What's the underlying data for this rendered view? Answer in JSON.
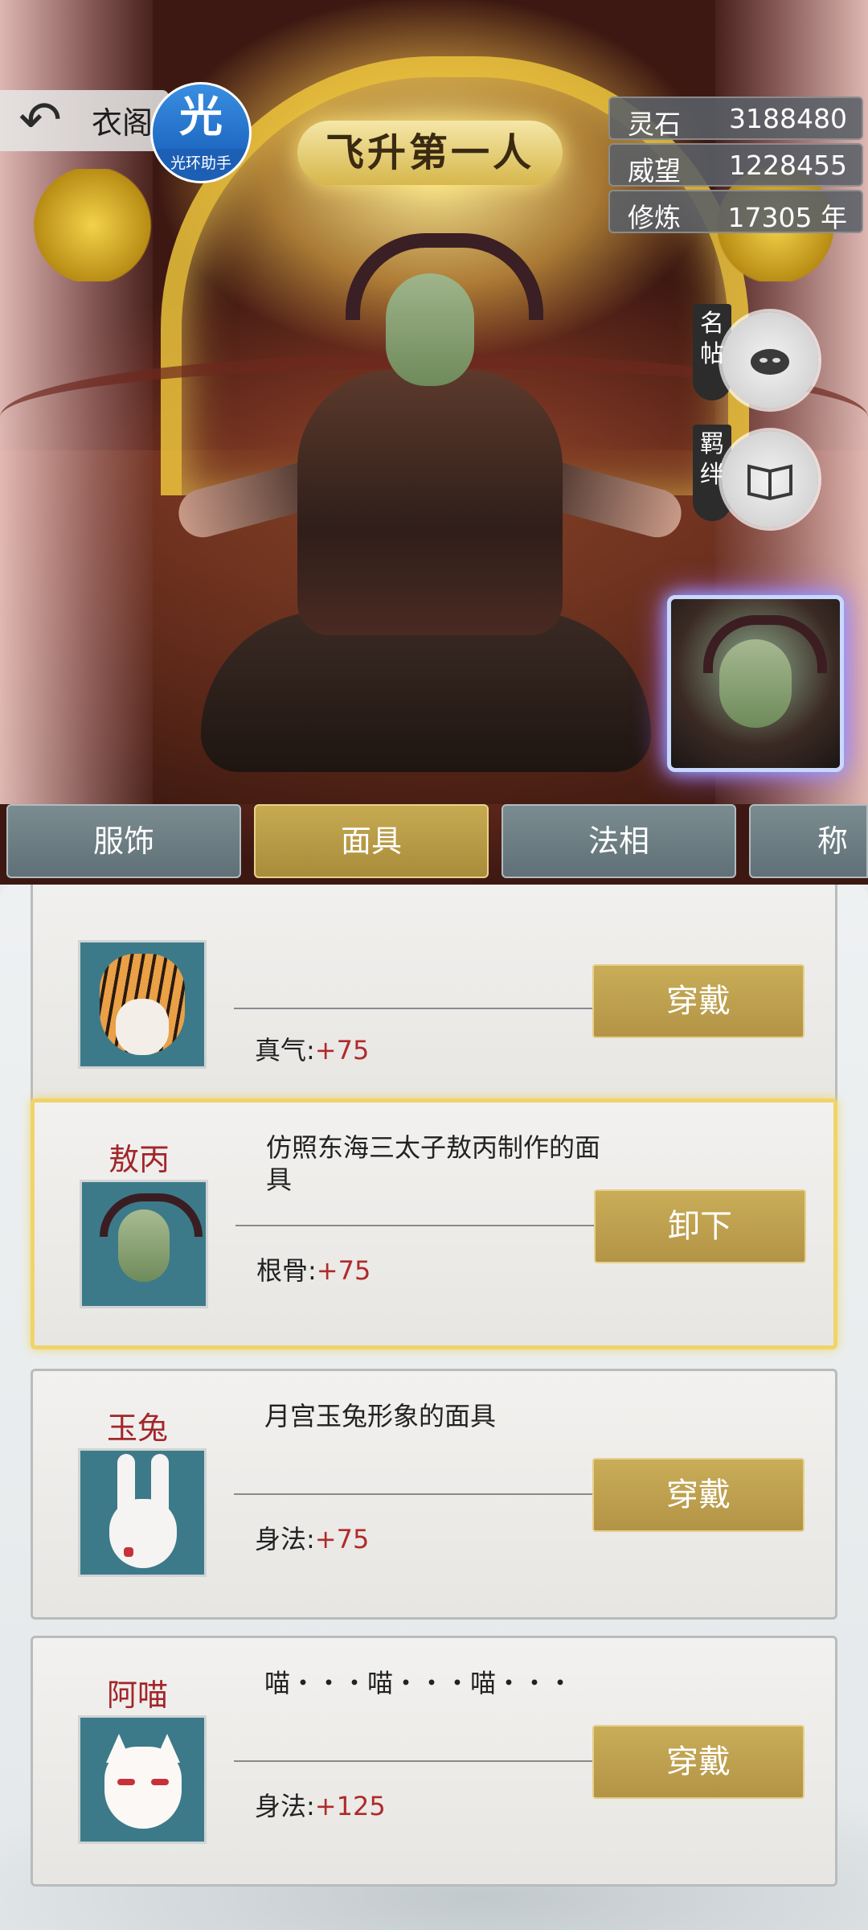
{
  "header": {
    "back_icon": "back-arrow-icon",
    "page_name": "衣阁",
    "title_banner": "飞升第一人",
    "helper": {
      "glyph": "光",
      "label": "光环助手"
    }
  },
  "stats": [
    {
      "label": "灵石",
      "value": "3188480"
    },
    {
      "label": "威望",
      "value": "1228455"
    },
    {
      "label": "修炼",
      "value": "17305 年"
    }
  ],
  "side_buttons": [
    {
      "tag": "名帖",
      "icon": "name-card-icon"
    },
    {
      "tag": "羁绊",
      "icon": "book-icon"
    }
  ],
  "tabs": [
    {
      "label": "服饰",
      "active": false
    },
    {
      "label": "面具",
      "active": true
    },
    {
      "label": "法相",
      "active": false
    },
    {
      "label": "称",
      "active": false
    }
  ],
  "items": [
    {
      "name": "",
      "description": "",
      "attr_label": "真气:",
      "attr_value": "+75",
      "button": "穿戴",
      "selected": false,
      "icon": "tiger-mask-icon"
    },
    {
      "name": "敖丙",
      "description": "仿照东海三太子敖丙制作的面具",
      "attr_label": "根骨:",
      "attr_value": "+75",
      "button": "卸下",
      "selected": true,
      "icon": "aobing-mask-icon"
    },
    {
      "name": "玉兔",
      "description": "月宫玉兔形象的面具",
      "attr_label": "身法:",
      "attr_value": "+75",
      "button": "穿戴",
      "selected": false,
      "icon": "rabbit-mask-icon"
    },
    {
      "name": "阿喵",
      "description": "喵・・・喵・・・喵・・・",
      "attr_label": "身法:",
      "attr_value": "+125",
      "button": "穿戴",
      "selected": false,
      "icon": "cat-mask-icon"
    }
  ]
}
